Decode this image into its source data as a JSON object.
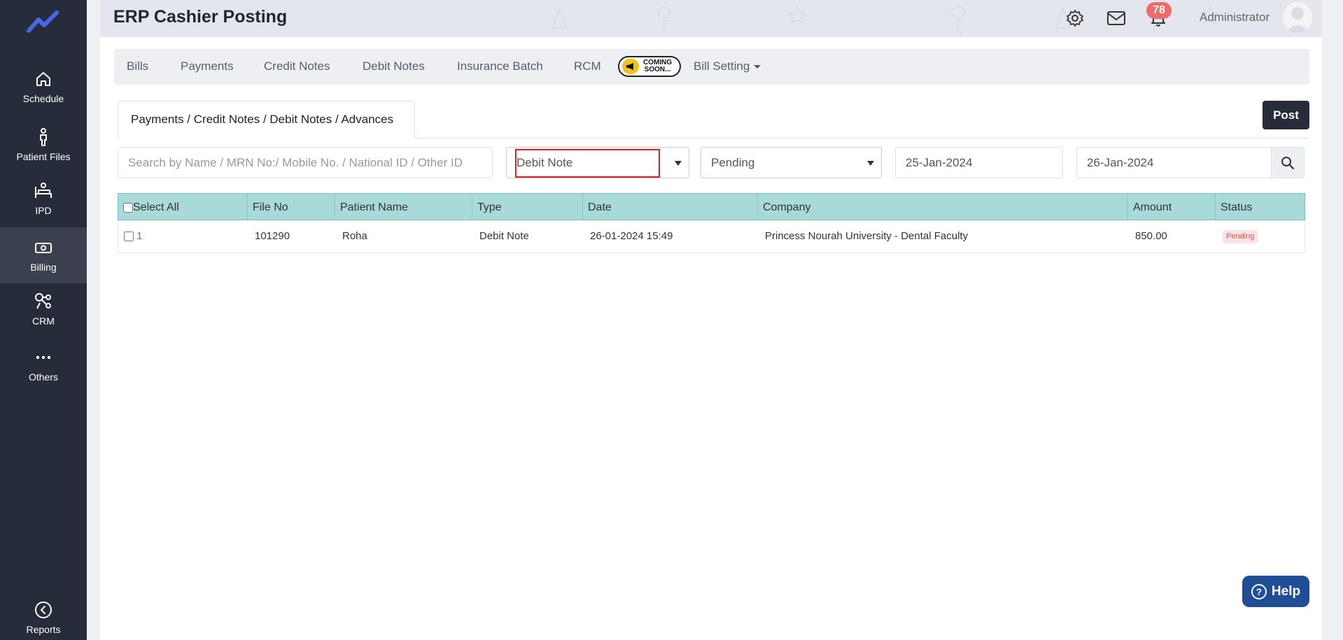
{
  "header": {
    "title": "ERP Cashier Posting",
    "notification_count": "78",
    "user_name": "Administrator"
  },
  "sidebar": {
    "items": [
      {
        "label": "Schedule",
        "icon": "home-icon"
      },
      {
        "label": "Patient Files",
        "icon": "person-icon"
      },
      {
        "label": "IPD",
        "icon": "bed-icon"
      },
      {
        "label": "Billing",
        "icon": "money-icon"
      },
      {
        "label": "CRM",
        "icon": "crm-icon"
      },
      {
        "label": "Others",
        "icon": "dots-icon"
      },
      {
        "label": "Reports",
        "icon": "back-arrow-icon"
      }
    ],
    "active": "Billing"
  },
  "tabs": {
    "bills": "Bills",
    "payments": "Payments",
    "credit_notes": "Credit Notes",
    "debit_notes": "Debit Notes",
    "insurance_batch": "Insurance Batch",
    "rcm": "RCM",
    "coming_soon_line1": "COMING",
    "coming_soon_line2": "SOON...",
    "bill_setting": "Bill Setting"
  },
  "subtab": {
    "label": "Payments / Credit Notes / Debit Notes / Advances"
  },
  "toolbar": {
    "post_label": "Post"
  },
  "filters": {
    "search_placeholder": "Search by Name / MRN No:/ Mobile No. / National ID / Other ID",
    "type_value": "Debit Note",
    "status_value": "Pending",
    "from_date": "25-Jan-2024",
    "to_date": "26-Jan-2024"
  },
  "table": {
    "headers": {
      "select_all": "Select All",
      "file_no": "File No",
      "patient_name": "Patient Name",
      "type": "Type",
      "date": "Date",
      "company": "Company",
      "amount": "Amount",
      "status": "Status"
    },
    "rows": [
      {
        "index": "1",
        "file_no": "101290",
        "patient_name": "Roha",
        "type": "Debit Note",
        "date": "26-01-2024 15:49",
        "company": "Princess Nourah University - Dental Faculty",
        "amount": "850.00",
        "status": "Pending"
      }
    ]
  },
  "help": {
    "label": "Help"
  },
  "colors": {
    "sidebar_bg": "#262c3a",
    "table_header": "#a8dada",
    "badge": "#ef6b6b",
    "help_button": "#1f4e96",
    "highlight": "#e01e1e"
  }
}
